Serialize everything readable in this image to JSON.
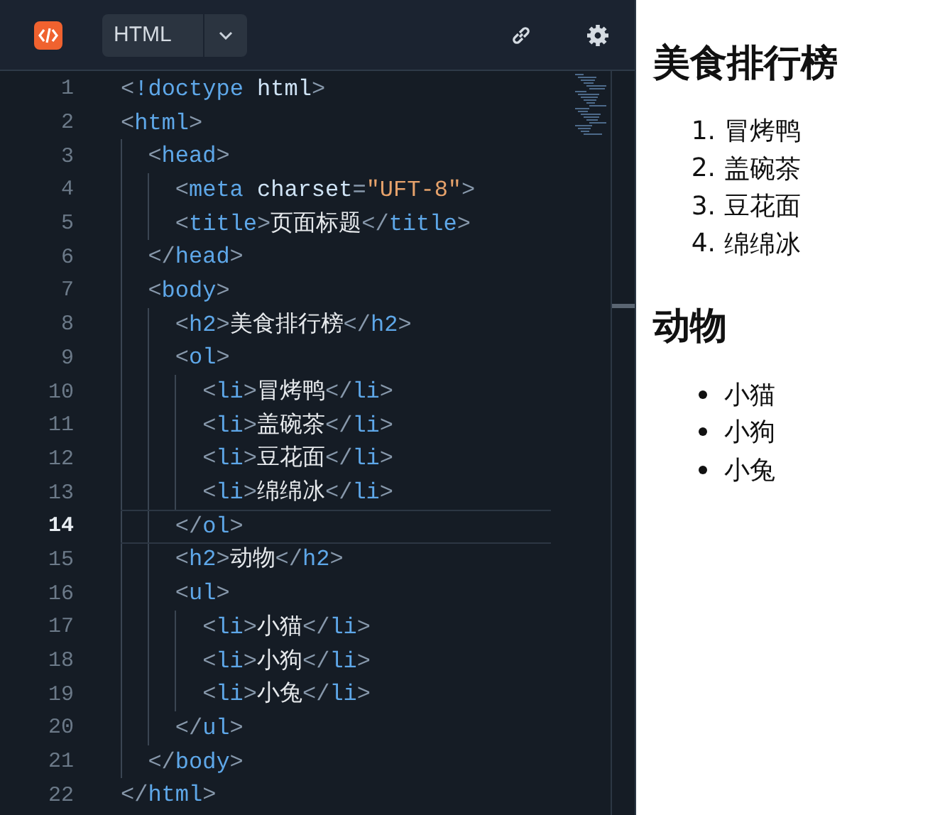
{
  "editor": {
    "language": "HTML",
    "lines": [
      {
        "number": "1",
        "active": false,
        "tokens": [
          {
            "kind": "punct",
            "text": "<"
          },
          {
            "kind": "tag",
            "text": "!doctype"
          },
          {
            "kind": "attr",
            "text": " html"
          },
          {
            "kind": "punct",
            "text": ">"
          }
        ]
      },
      {
        "number": "2",
        "active": false,
        "tokens": [
          {
            "kind": "punct",
            "text": "<"
          },
          {
            "kind": "tag",
            "text": "html"
          },
          {
            "kind": "punct",
            "text": ">"
          }
        ],
        "children": [
          {
            "number": "3",
            "active": false,
            "tokens": [
              {
                "kind": "punct",
                "text": "<"
              },
              {
                "kind": "tag",
                "text": "head"
              },
              {
                "kind": "punct",
                "text": ">"
              }
            ],
            "children": [
              {
                "number": "4",
                "active": false,
                "tokens": [
                  {
                    "kind": "punct",
                    "text": "<"
                  },
                  {
                    "kind": "tag",
                    "text": "meta"
                  },
                  {
                    "kind": "attr",
                    "text": " charset"
                  },
                  {
                    "kind": "punct",
                    "text": "="
                  },
                  {
                    "kind": "string",
                    "text": "\"UFT-8\""
                  },
                  {
                    "kind": "punct",
                    "text": ">"
                  }
                ]
              },
              {
                "number": "5",
                "active": false,
                "tokens": [
                  {
                    "kind": "punct",
                    "text": "<"
                  },
                  {
                    "kind": "tag",
                    "text": "title"
                  },
                  {
                    "kind": "punct",
                    "text": ">"
                  },
                  {
                    "kind": "text",
                    "text": "页面标题"
                  },
                  {
                    "kind": "punct",
                    "text": "</"
                  },
                  {
                    "kind": "tag",
                    "text": "title"
                  },
                  {
                    "kind": "punct",
                    "text": ">"
                  }
                ]
              }
            ]
          },
          {
            "number": "6",
            "active": false,
            "tokens": [
              {
                "kind": "punct",
                "text": "</"
              },
              {
                "kind": "tag",
                "text": "head"
              },
              {
                "kind": "punct",
                "text": ">"
              }
            ]
          },
          {
            "number": "7",
            "active": false,
            "tokens": [
              {
                "kind": "punct",
                "text": "<"
              },
              {
                "kind": "tag",
                "text": "body"
              },
              {
                "kind": "punct",
                "text": ">"
              }
            ],
            "children": [
              {
                "number": "8",
                "active": false,
                "tokens": [
                  {
                    "kind": "punct",
                    "text": "<"
                  },
                  {
                    "kind": "tag",
                    "text": "h2"
                  },
                  {
                    "kind": "punct",
                    "text": ">"
                  },
                  {
                    "kind": "text",
                    "text": "美食排行榜"
                  },
                  {
                    "kind": "punct",
                    "text": "</"
                  },
                  {
                    "kind": "tag",
                    "text": "h2"
                  },
                  {
                    "kind": "punct",
                    "text": ">"
                  }
                ]
              },
              {
                "number": "9",
                "active": false,
                "tokens": [
                  {
                    "kind": "punct",
                    "text": "<"
                  },
                  {
                    "kind": "tag",
                    "text": "ol"
                  },
                  {
                    "kind": "punct",
                    "text": ">"
                  }
                ],
                "children": [
                  {
                    "number": "10",
                    "active": false,
                    "tokens": [
                      {
                        "kind": "punct",
                        "text": "<"
                      },
                      {
                        "kind": "tag",
                        "text": "li"
                      },
                      {
                        "kind": "punct",
                        "text": ">"
                      },
                      {
                        "kind": "text",
                        "text": "冒烤鸭"
                      },
                      {
                        "kind": "punct",
                        "text": "</"
                      },
                      {
                        "kind": "tag",
                        "text": "li"
                      },
                      {
                        "kind": "punct",
                        "text": ">"
                      }
                    ]
                  },
                  {
                    "number": "11",
                    "active": false,
                    "tokens": [
                      {
                        "kind": "punct",
                        "text": "<"
                      },
                      {
                        "kind": "tag",
                        "text": "li"
                      },
                      {
                        "kind": "punct",
                        "text": ">"
                      },
                      {
                        "kind": "text",
                        "text": "盖碗茶"
                      },
                      {
                        "kind": "punct",
                        "text": "</"
                      },
                      {
                        "kind": "tag",
                        "text": "li"
                      },
                      {
                        "kind": "punct",
                        "text": ">"
                      }
                    ]
                  },
                  {
                    "number": "12",
                    "active": false,
                    "tokens": [
                      {
                        "kind": "punct",
                        "text": "<"
                      },
                      {
                        "kind": "tag",
                        "text": "li"
                      },
                      {
                        "kind": "punct",
                        "text": ">"
                      },
                      {
                        "kind": "text",
                        "text": "豆花面"
                      },
                      {
                        "kind": "punct",
                        "text": "</"
                      },
                      {
                        "kind": "tag",
                        "text": "li"
                      },
                      {
                        "kind": "punct",
                        "text": ">"
                      }
                    ]
                  },
                  {
                    "number": "13",
                    "active": false,
                    "tokens": [
                      {
                        "kind": "punct",
                        "text": "<"
                      },
                      {
                        "kind": "tag",
                        "text": "li"
                      },
                      {
                        "kind": "punct",
                        "text": ">"
                      },
                      {
                        "kind": "text",
                        "text": "绵绵冰"
                      },
                      {
                        "kind": "punct",
                        "text": "</"
                      },
                      {
                        "kind": "tag",
                        "text": "li"
                      },
                      {
                        "kind": "punct",
                        "text": ">"
                      }
                    ]
                  }
                ]
              },
              {
                "number": "14",
                "active": true,
                "tokens": [
                  {
                    "kind": "punct",
                    "text": "</"
                  },
                  {
                    "kind": "tag",
                    "text": "ol"
                  },
                  {
                    "kind": "punct",
                    "text": ">"
                  }
                ]
              },
              {
                "number": "15",
                "active": false,
                "tokens": [
                  {
                    "kind": "punct",
                    "text": "<"
                  },
                  {
                    "kind": "tag",
                    "text": "h2"
                  },
                  {
                    "kind": "punct",
                    "text": ">"
                  },
                  {
                    "kind": "text",
                    "text": "动物"
                  },
                  {
                    "kind": "punct",
                    "text": "</"
                  },
                  {
                    "kind": "tag",
                    "text": "h2"
                  },
                  {
                    "kind": "punct",
                    "text": ">"
                  }
                ]
              },
              {
                "number": "16",
                "active": false,
                "tokens": [
                  {
                    "kind": "punct",
                    "text": "<"
                  },
                  {
                    "kind": "tag",
                    "text": "ul"
                  },
                  {
                    "kind": "punct",
                    "text": ">"
                  }
                ],
                "children": [
                  {
                    "number": "17",
                    "active": false,
                    "tokens": [
                      {
                        "kind": "punct",
                        "text": "<"
                      },
                      {
                        "kind": "tag",
                        "text": "li"
                      },
                      {
                        "kind": "punct",
                        "text": ">"
                      },
                      {
                        "kind": "text",
                        "text": "小猫"
                      },
                      {
                        "kind": "punct",
                        "text": "</"
                      },
                      {
                        "kind": "tag",
                        "text": "li"
                      },
                      {
                        "kind": "punct",
                        "text": ">"
                      }
                    ]
                  },
                  {
                    "number": "18",
                    "active": false,
                    "tokens": [
                      {
                        "kind": "punct",
                        "text": "<"
                      },
                      {
                        "kind": "tag",
                        "text": "li"
                      },
                      {
                        "kind": "punct",
                        "text": ">"
                      },
                      {
                        "kind": "text",
                        "text": "小狗"
                      },
                      {
                        "kind": "punct",
                        "text": "</"
                      },
                      {
                        "kind": "tag",
                        "text": "li"
                      },
                      {
                        "kind": "punct",
                        "text": ">"
                      }
                    ]
                  },
                  {
                    "number": "19",
                    "active": false,
                    "tokens": [
                      {
                        "kind": "punct",
                        "text": "<"
                      },
                      {
                        "kind": "tag",
                        "text": "li"
                      },
                      {
                        "kind": "punct",
                        "text": ">"
                      },
                      {
                        "kind": "text",
                        "text": "小兔"
                      },
                      {
                        "kind": "punct",
                        "text": "</"
                      },
                      {
                        "kind": "tag",
                        "text": "li"
                      },
                      {
                        "kind": "punct",
                        "text": ">"
                      }
                    ]
                  }
                ]
              },
              {
                "number": "20",
                "active": false,
                "tokens": [
                  {
                    "kind": "punct",
                    "text": "</"
                  },
                  {
                    "kind": "tag",
                    "text": "ul"
                  },
                  {
                    "kind": "punct",
                    "text": ">"
                  }
                ]
              }
            ]
          },
          {
            "number": "21",
            "active": false,
            "tokens": [
              {
                "kind": "punct",
                "text": "</"
              },
              {
                "kind": "tag",
                "text": "body"
              },
              {
                "kind": "punct",
                "text": ">"
              }
            ]
          }
        ]
      },
      {
        "number": "22",
        "active": false,
        "tokens": [
          {
            "kind": "punct",
            "text": "</"
          },
          {
            "kind": "tag",
            "text": "html"
          },
          {
            "kind": "punct",
            "text": ">"
          }
        ]
      }
    ]
  },
  "preview": {
    "sections": [
      {
        "heading": "美食排行榜",
        "kind": "ordered",
        "items": [
          {
            "marker": "1.",
            "text": "冒烤鸭"
          },
          {
            "marker": "2.",
            "text": "盖碗茶"
          },
          {
            "marker": "3.",
            "text": "豆花面"
          },
          {
            "marker": "4.",
            "text": "绵绵冰"
          }
        ]
      },
      {
        "heading": "动物",
        "kind": "unordered",
        "items": [
          {
            "text": "小猫"
          },
          {
            "text": "小狗"
          },
          {
            "text": "小兔"
          }
        ]
      }
    ]
  }
}
